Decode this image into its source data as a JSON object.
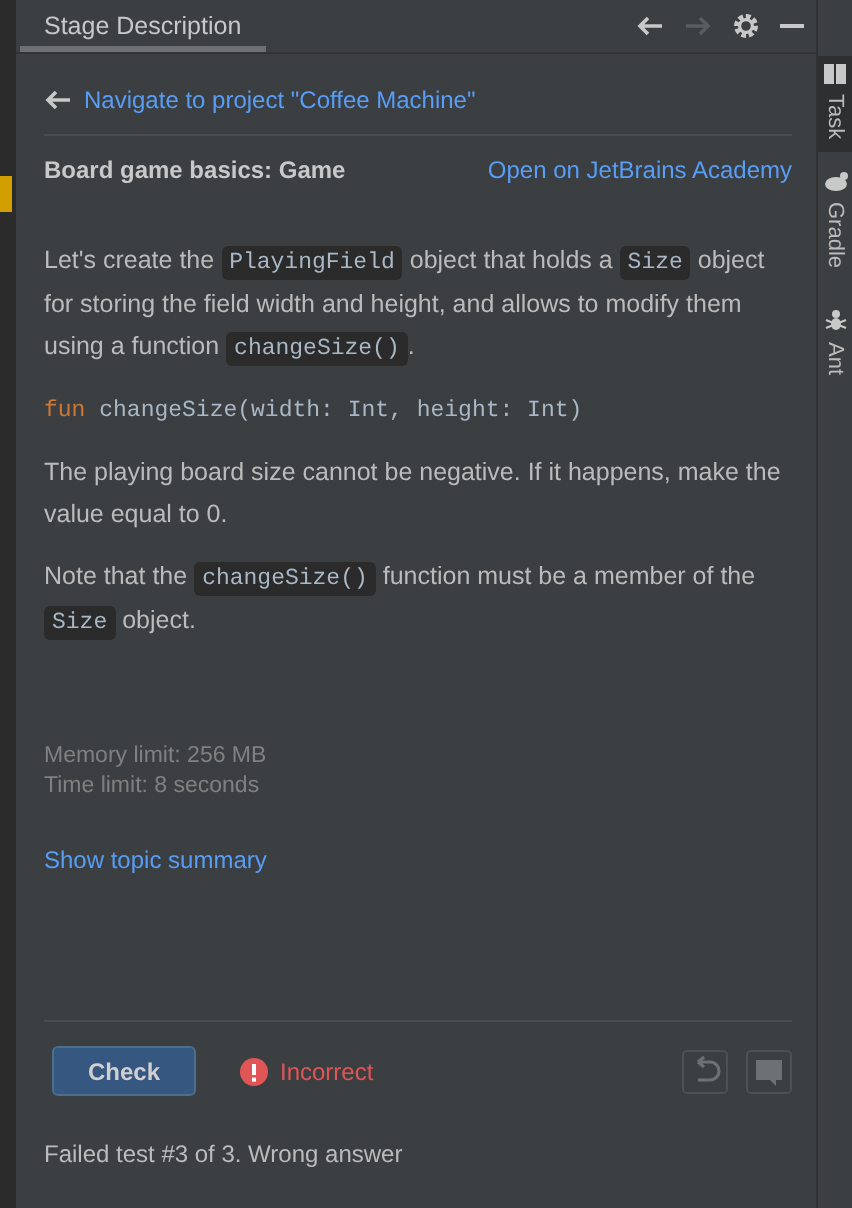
{
  "panel": {
    "tab": "Stage Description",
    "back_enabled": true,
    "forward_enabled": false
  },
  "navigate_link": "Navigate to project \"Coffee Machine\"",
  "task": {
    "title": "Board game basics: Game",
    "academy_link": "Open on JetBrains Academy"
  },
  "body": [
    {
      "kind": "text",
      "parts": [
        {
          "text": "Let's create the ",
          "code": false
        },
        {
          "text": "PlayingField",
          "code": true
        },
        {
          "text": " object that holds a ",
          "code": false
        },
        {
          "text": "Size",
          "code": true
        },
        {
          "text": " object for storing the field width and height, and allows to modify them using a function ",
          "code": false
        },
        {
          "text": "changeSize()",
          "code": true
        },
        {
          "text": ".",
          "code": false
        }
      ]
    },
    {
      "kind": "code",
      "parts": [
        {
          "text": "fun",
          "keyword": true
        },
        {
          "text": " changeSize(width: Int, height: Int)",
          "keyword": false
        }
      ]
    },
    {
      "kind": "text",
      "parts": [
        {
          "text": "The playing board size cannot be negative. If it happens, make the value equal to 0.",
          "code": false
        }
      ]
    },
    {
      "kind": "text",
      "parts": [
        {
          "text": "Note that the ",
          "code": false
        },
        {
          "text": "changeSize()",
          "code": true
        },
        {
          "text": " function must be a member of the ",
          "code": false
        },
        {
          "text": "Size",
          "code": true
        },
        {
          "text": " object.",
          "code": false
        }
      ]
    }
  ],
  "limits": [
    "Memory limit: 256 MB",
    "Time limit: 8 seconds"
  ],
  "summary_link": "Show topic summary",
  "check_button": "Check",
  "result": {
    "kind": "incorrect",
    "label": "Incorrect"
  },
  "message": "Failed test #3 of 3. Wrong answer",
  "side_tabs": [
    {
      "label": "Task",
      "selected": true,
      "kind": "task"
    },
    {
      "label": "Gradle",
      "selected": false,
      "kind": "gradle"
    },
    {
      "label": "Ant",
      "selected": false,
      "kind": "ant"
    }
  ]
}
